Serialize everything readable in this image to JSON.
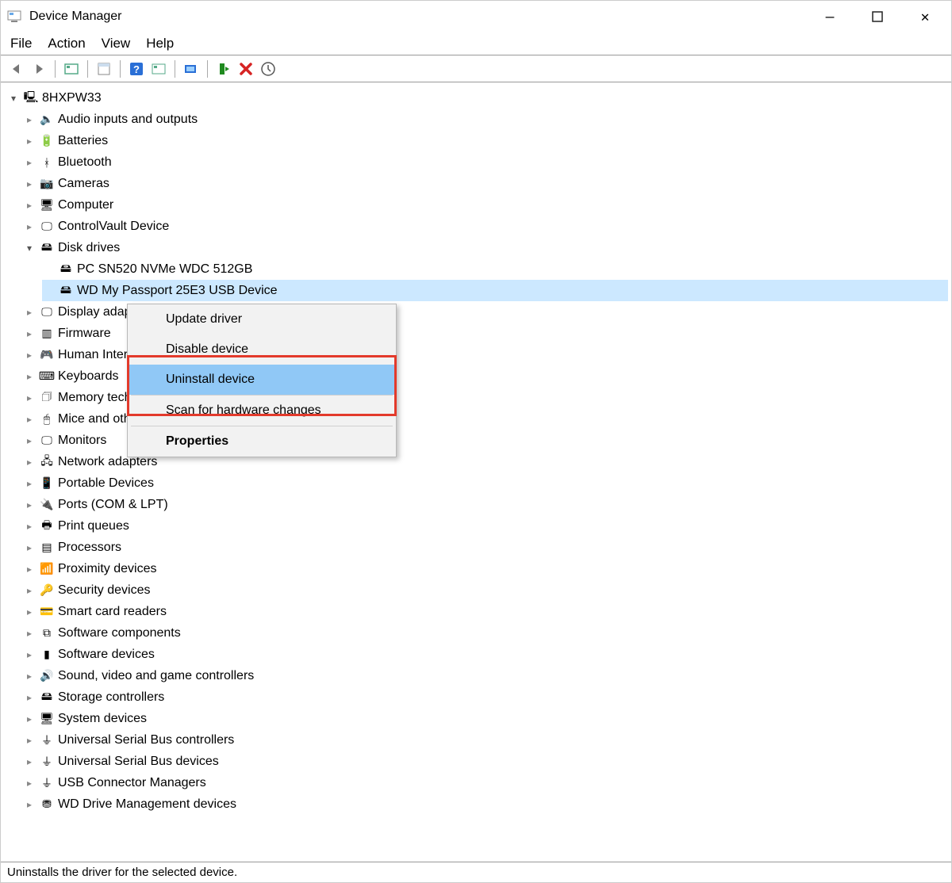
{
  "window": {
    "title": "Device Manager"
  },
  "menubar": {
    "file": "File",
    "action": "Action",
    "view": "View",
    "help": "Help"
  },
  "toolbar": {
    "back": "back-icon",
    "forward": "forward-icon",
    "properties": "properties-icon",
    "refresh": "refresh-icon",
    "help": "help-icon",
    "update": "update-icon",
    "monitor": "monitor-icon",
    "disable": "disable-icon",
    "uninstall": "uninstall-icon",
    "scan": "scan-icon"
  },
  "tree": {
    "root": {
      "label": "8HXPW33",
      "expanded": true
    },
    "items": [
      {
        "label": "Audio inputs and outputs",
        "icon": "speaker-icon",
        "expanded": false
      },
      {
        "label": "Batteries",
        "icon": "battery-icon",
        "expanded": false
      },
      {
        "label": "Bluetooth",
        "icon": "bluetooth-icon",
        "expanded": false
      },
      {
        "label": "Cameras",
        "icon": "camera-icon",
        "expanded": false
      },
      {
        "label": "Computer",
        "icon": "computer-icon",
        "expanded": false
      },
      {
        "label": "ControlVault Device",
        "icon": "monitor-icon",
        "expanded": false
      },
      {
        "label": "Disk drives",
        "icon": "disk-icon",
        "expanded": true,
        "children": [
          {
            "label": "PC SN520 NVMe WDC 512GB",
            "icon": "drive-icon"
          },
          {
            "label": "WD My Passport 25E3 USB Device",
            "icon": "drive-icon",
            "selected": true
          }
        ]
      },
      {
        "label": "Display adapters",
        "icon": "display-icon",
        "expanded": false
      },
      {
        "label": "Firmware",
        "icon": "firmware-icon",
        "expanded": false
      },
      {
        "label": "Human Interface Devices",
        "icon": "hid-icon",
        "expanded": false
      },
      {
        "label": "Keyboards",
        "icon": "keyboard-icon",
        "expanded": false
      },
      {
        "label": "Memory technology devices",
        "icon": "memory-icon",
        "expanded": false
      },
      {
        "label": "Mice and other pointing devices",
        "icon": "mouse-icon",
        "expanded": false
      },
      {
        "label": "Monitors",
        "icon": "monitor-icon",
        "expanded": false
      },
      {
        "label": "Network adapters",
        "icon": "network-icon",
        "expanded": false
      },
      {
        "label": "Portable Devices",
        "icon": "portable-icon",
        "expanded": false
      },
      {
        "label": "Ports (COM & LPT)",
        "icon": "ports-icon",
        "expanded": false
      },
      {
        "label": "Print queues",
        "icon": "printer-icon",
        "expanded": false
      },
      {
        "label": "Processors",
        "icon": "cpu-icon",
        "expanded": false
      },
      {
        "label": "Proximity devices",
        "icon": "proximity-icon",
        "expanded": false
      },
      {
        "label": "Security devices",
        "icon": "security-icon",
        "expanded": false
      },
      {
        "label": "Smart card readers",
        "icon": "smartcard-icon",
        "expanded": false
      },
      {
        "label": "Software components",
        "icon": "software-component-icon",
        "expanded": false
      },
      {
        "label": "Software devices",
        "icon": "software-device-icon",
        "expanded": false
      },
      {
        "label": "Sound, video and game controllers",
        "icon": "sound-icon",
        "expanded": false
      },
      {
        "label": "Storage controllers",
        "icon": "storage-icon",
        "expanded": false
      },
      {
        "label": "System devices",
        "icon": "system-icon",
        "expanded": false
      },
      {
        "label": "Universal Serial Bus controllers",
        "icon": "usb-icon",
        "expanded": false
      },
      {
        "label": "Universal Serial Bus devices",
        "icon": "usb-icon",
        "expanded": false
      },
      {
        "label": "USB Connector Managers",
        "icon": "usb-icon",
        "expanded": false
      },
      {
        "label": "WD Drive Management devices",
        "icon": "drive-mgmt-icon",
        "expanded": false
      }
    ]
  },
  "context_menu": {
    "items": [
      {
        "label": "Update driver",
        "hover": false
      },
      {
        "label": "Disable device",
        "hover": false
      },
      {
        "label": "Uninstall device",
        "hover": true
      },
      {
        "separator": true
      },
      {
        "label": "Scan for hardware changes",
        "hover": false
      },
      {
        "separator": true
      },
      {
        "label": "Properties",
        "bold": true,
        "hover": false
      }
    ]
  },
  "statusbar": {
    "text": "Uninstalls the driver for the selected device."
  }
}
